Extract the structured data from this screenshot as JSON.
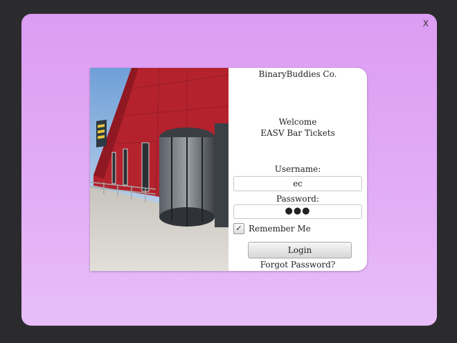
{
  "window": {
    "close_label": "X"
  },
  "company": "BinaryBuddies Co.",
  "welcome": {
    "line1": "Welcome",
    "line2": "EASV Bar Tickets"
  },
  "form": {
    "username_label": "Username:",
    "username_value": "ec",
    "password_label": "Password:",
    "password_masked": "●●●",
    "remember_label": "Remember Me",
    "remember_checked": true,
    "login_label": "Login",
    "forgot_label": "Forgot Password?"
  },
  "colors": {
    "background": "#2b2b2e",
    "panel": "#dc9cf2",
    "building": "#b3222d"
  }
}
